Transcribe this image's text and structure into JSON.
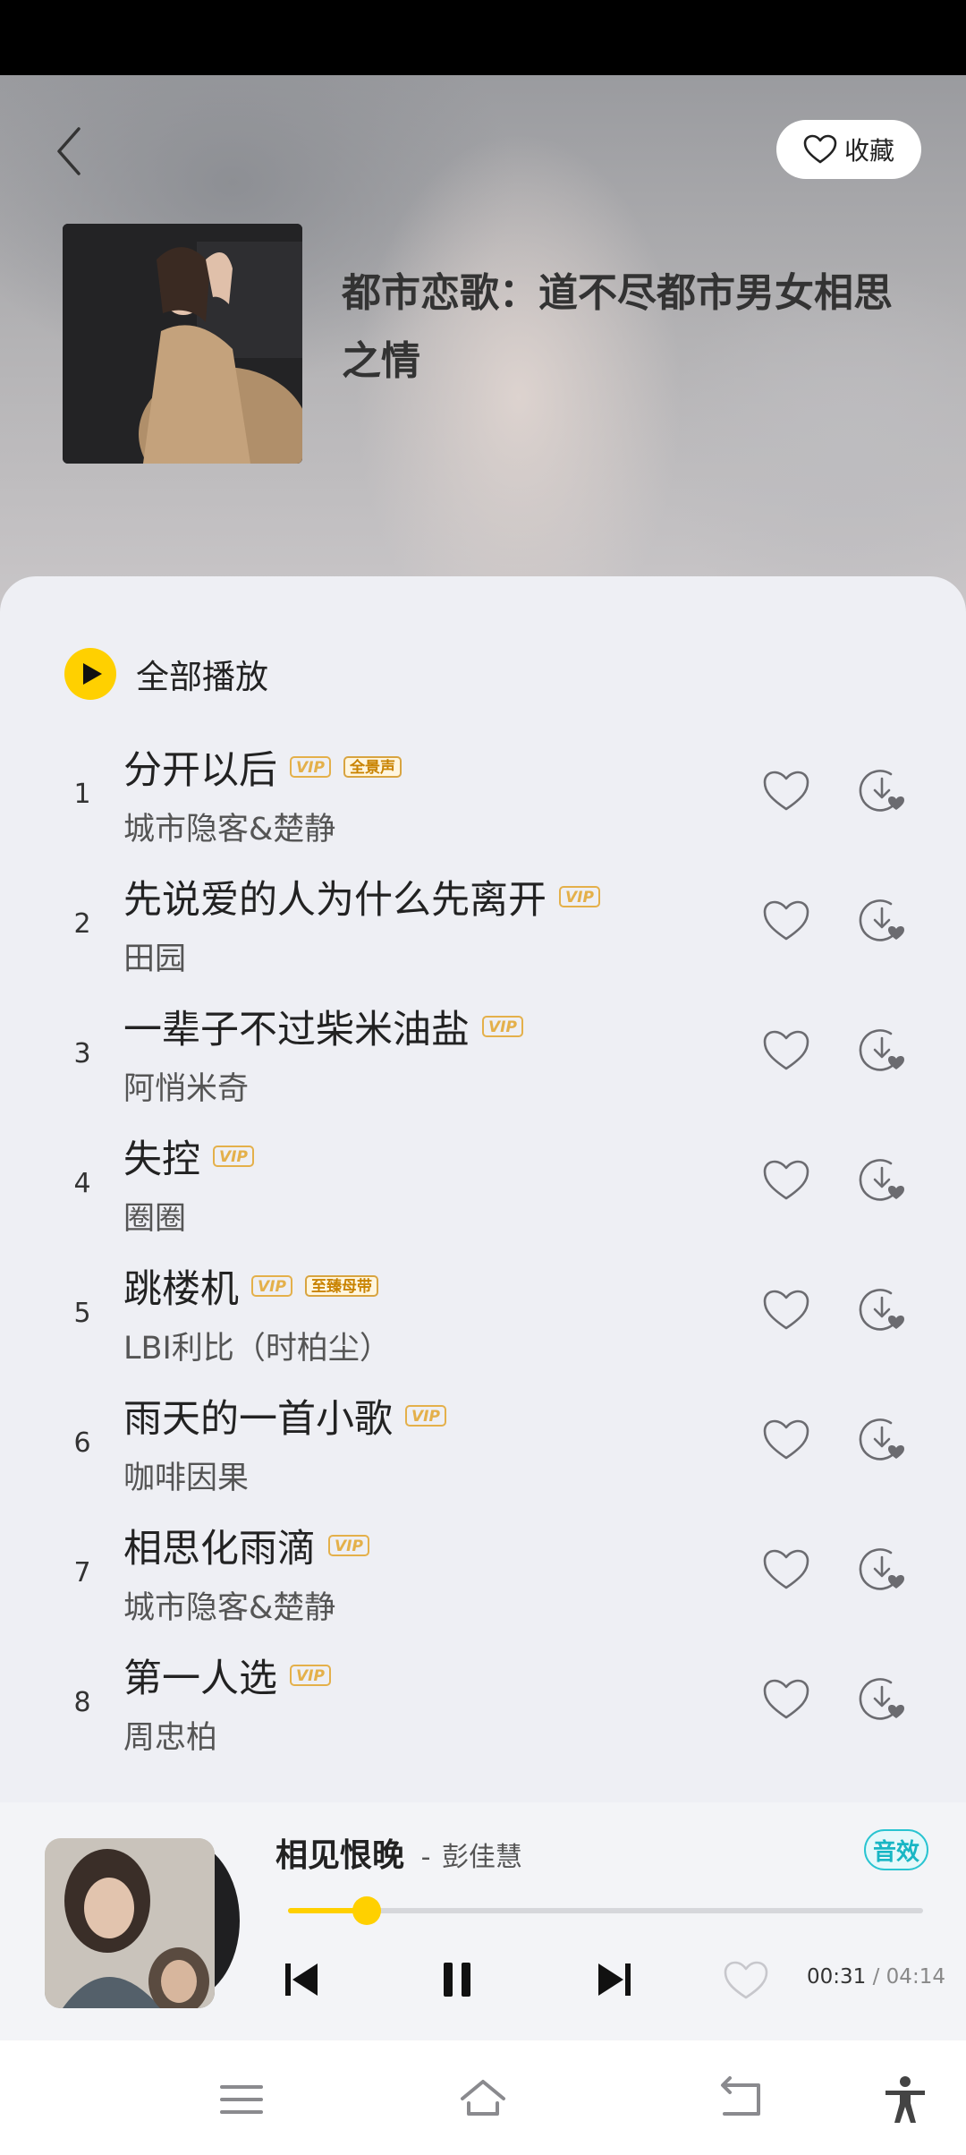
{
  "header": {
    "favorite_label": "收藏",
    "album_title": "都市恋歌：道不尽都市男女相思之情"
  },
  "play_all_label": "全部播放",
  "songs": [
    {
      "index": "1",
      "title": "分开以后",
      "badges": [
        "VIP",
        "全景声"
      ],
      "artist": "城市隐客&楚静"
    },
    {
      "index": "2",
      "title": "先说爱的人为什么先离开",
      "badges": [
        "VIP"
      ],
      "artist": "田园"
    },
    {
      "index": "3",
      "title": "一辈子不过柴米油盐",
      "badges": [
        "VIP"
      ],
      "artist": "阿悄米奇"
    },
    {
      "index": "4",
      "title": "失控",
      "badges": [
        "VIP"
      ],
      "artist": "圈圈"
    },
    {
      "index": "5",
      "title": "跳楼机",
      "badges": [
        "VIP",
        "至臻母带"
      ],
      "artist": "LBI利比（时柏尘）"
    },
    {
      "index": "6",
      "title": "雨天的一首小歌",
      "badges": [
        "VIP"
      ],
      "artist": "咖啡因果"
    },
    {
      "index": "7",
      "title": "相思化雨滴",
      "badges": [
        "VIP"
      ],
      "artist": "城市隐客&楚静"
    },
    {
      "index": "8",
      "title": "第一人选",
      "badges": [
        "VIP"
      ],
      "artist": "周忠柏"
    }
  ],
  "player": {
    "title": "相见恨晚",
    "separator": "-",
    "artist": "彭佳慧",
    "effect_label": "音效",
    "progress": 0.1235,
    "time_current": "00:31",
    "time_separator": "/",
    "time_total": "04:14"
  },
  "icons": {
    "back": "chevron-left-icon",
    "favorite": "heart-icon",
    "play_all": "play-icon",
    "like": "heart-icon",
    "download": "download-icon",
    "prev": "skip-previous-icon",
    "pause": "pause-icon",
    "next": "skip-next-icon",
    "nav_menu": "menu-icon",
    "nav_home": "home-icon",
    "nav_back": "back-icon",
    "nav_accessibility": "accessibility-icon"
  },
  "colors": {
    "accent": "#ffd000",
    "vip": "#e4b04a",
    "effect": "#29c4d1"
  }
}
